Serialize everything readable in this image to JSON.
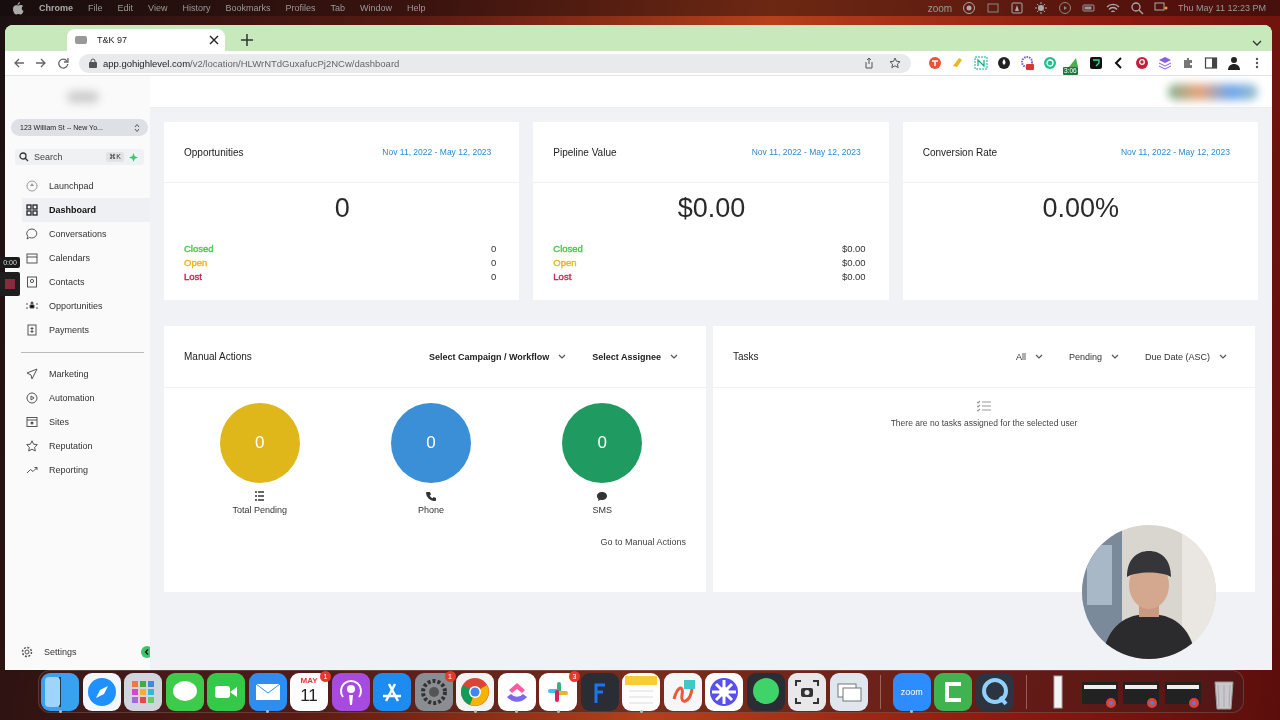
{
  "menubar": {
    "app": "Chrome",
    "menus": [
      "File",
      "Edit",
      "View",
      "History",
      "Bookmarks",
      "Profiles",
      "Tab",
      "Window",
      "Help"
    ],
    "status_app": "zoom",
    "clock": "Thu May 11  12:23 PM"
  },
  "browser": {
    "tabs": [
      {
        "title": "T&K 97",
        "selected": true
      }
    ],
    "url_host": "app.gohighlevel.com",
    "url_path": "/v2/location/HLWrNTdGuxafucPj2NCw/dashboard",
    "timer_badge": "3:06"
  },
  "recording": {
    "time": "0:00"
  },
  "sidebar": {
    "location": "123 William St -- New Yo...",
    "search_placeholder": "Search",
    "shortcut": "⌘K",
    "groups": [
      [
        {
          "label": "Launchpad",
          "selected": false
        },
        {
          "label": "Dashboard",
          "selected": true
        },
        {
          "label": "Conversations",
          "selected": false
        },
        {
          "label": "Calendars",
          "selected": false
        },
        {
          "label": "Contacts",
          "selected": false
        },
        {
          "label": "Opportunities",
          "selected": false
        },
        {
          "label": "Payments",
          "selected": false
        }
      ],
      [
        {
          "label": "Marketing",
          "selected": false
        },
        {
          "label": "Automation",
          "selected": false
        },
        {
          "label": "Sites",
          "selected": false
        },
        {
          "label": "Reputation",
          "selected": false
        },
        {
          "label": "Reporting",
          "selected": false
        }
      ]
    ],
    "settings": "Settings"
  },
  "stats": [
    {
      "title": "Opportunities",
      "range": "Nov 11, 2022 - May 12, 2023",
      "total": "0",
      "rows": [
        {
          "label": "Closed",
          "value": "0",
          "color": "#4cc94c"
        },
        {
          "label": "Open",
          "value": "0",
          "color": "#e8b81c"
        },
        {
          "label": "Lost",
          "value": "0",
          "color": "#c8254f"
        }
      ]
    },
    {
      "title": "Pipeline Value",
      "range": "Nov 11, 2022 - May 12, 2023",
      "total": "$0.00",
      "rows": [
        {
          "label": "Closed",
          "value": "$0.00",
          "color": "#4cc94c"
        },
        {
          "label": "Open",
          "value": "$0.00",
          "color": "#e8b81c"
        },
        {
          "label": "Lost",
          "value": "$0.00",
          "color": "#c8254f"
        }
      ]
    },
    {
      "title": "Conversion Rate",
      "range": "Nov 11, 2022 - May 12, 2023",
      "total": "0.00%"
    }
  ],
  "manual_actions": {
    "title": "Manual Actions",
    "filters": [
      "Select Campaign / Workflow",
      "Select Assignee"
    ],
    "counters": [
      {
        "count": "0",
        "label": "Total Pending",
        "color": "#e0b71a"
      },
      {
        "count": "0",
        "label": "Phone",
        "color": "#3a8fd6"
      },
      {
        "count": "0",
        "label": "SMS",
        "color": "#1f9b62"
      }
    ],
    "link": "Go to Manual Actions"
  },
  "tasks": {
    "title": "Tasks",
    "filters": [
      "All",
      "Pending",
      "Due Date (ASC)"
    ],
    "empty": "There are no tasks assigned for the selected user"
  },
  "dock": [
    {
      "kind": "finder",
      "running": true
    },
    {
      "kind": "safari",
      "running": false
    },
    {
      "kind": "launchpad",
      "running": false
    },
    {
      "kind": "messages",
      "running": false
    },
    {
      "kind": "facetime",
      "running": false
    },
    {
      "kind": "mail",
      "running": true
    },
    {
      "kind": "calendar",
      "month": "MAY",
      "day": "11",
      "badge": "1",
      "running": false
    },
    {
      "kind": "podcasts",
      "running": false
    },
    {
      "kind": "appstore",
      "running": false
    },
    {
      "kind": "settings",
      "badge": "1",
      "running": false
    },
    {
      "kind": "chrome",
      "running": true
    },
    {
      "kind": "clickup",
      "running": true
    },
    {
      "kind": "slack",
      "badge": "3",
      "running": true
    },
    {
      "kind": "f",
      "running": false
    },
    {
      "kind": "notes",
      "running": true
    },
    {
      "kind": "freeform",
      "running": false
    },
    {
      "kind": "star",
      "running": false
    },
    {
      "kind": "chat",
      "running": false
    },
    {
      "kind": "screenshot",
      "running": false
    },
    {
      "kind": "preview",
      "running": false
    },
    {
      "kind": "separator"
    },
    {
      "kind": "zoom",
      "label": "zoom",
      "running": true
    },
    {
      "kind": "camtasia",
      "running": false
    },
    {
      "kind": "quicktime",
      "running": false
    },
    {
      "kind": "separator"
    },
    {
      "kind": "document",
      "running": false
    },
    {
      "kind": "window",
      "running": false
    },
    {
      "kind": "window",
      "running": false
    },
    {
      "kind": "window",
      "running": false
    },
    {
      "kind": "trash",
      "running": false
    }
  ]
}
